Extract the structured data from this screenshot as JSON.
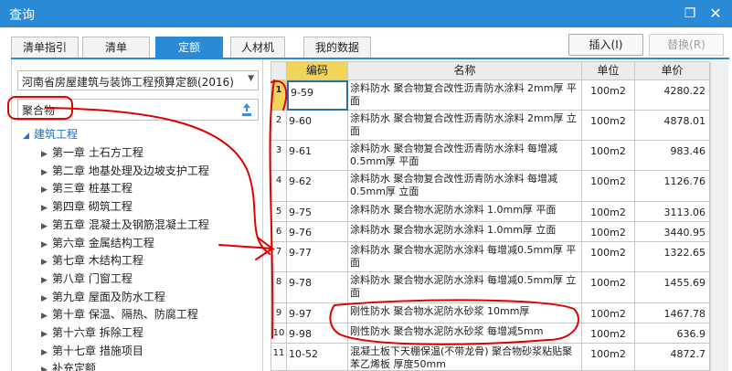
{
  "window": {
    "title": "查询",
    "close_glyph": "✕",
    "max_glyph": "❐"
  },
  "tabs": [
    {
      "label": "清单指引",
      "active": false
    },
    {
      "label": "清单",
      "active": false
    },
    {
      "label": "定额",
      "active": true
    },
    {
      "label": "人材机",
      "active": false
    },
    {
      "label": "我的数据",
      "active": false
    }
  ],
  "buttons": {
    "insert": "插入(I)",
    "replace": "替换(R)"
  },
  "library": {
    "selected": "河南省房屋建筑与装饰工程预算定额(2016)"
  },
  "search": {
    "value": "聚合物"
  },
  "tree": {
    "root": "建筑工程",
    "chapters": [
      "第一章 土石方工程",
      "第二章 地基处理及边坡支护工程",
      "第三章 桩基工程",
      "第四章 砌筑工程",
      "第五章 混凝土及钢筋混凝土工程",
      "第六章 金属结构工程",
      "第七章 木结构工程",
      "第八章 门窗工程",
      "第九章 屋面及防水工程",
      "第十章 保温、隔热、防腐工程",
      "第十六章 拆除工程",
      "第十七章 措施项目",
      "补充定额"
    ]
  },
  "grid": {
    "headers": {
      "code": "编码",
      "name": "名称",
      "unit": "单位",
      "price": "单价"
    },
    "rows": [
      {
        "idx": "1",
        "code": "9-59",
        "name": "涂料防水 聚合物复合改性沥青防水涂料 2mm厚 平面",
        "unit": "100m2",
        "price": "4280.22"
      },
      {
        "idx": "2",
        "code": "9-60",
        "name": "涂料防水 聚合物复合改性沥青防水涂料 2mm厚 立面",
        "unit": "100m2",
        "price": "4878.01"
      },
      {
        "idx": "3",
        "code": "9-61",
        "name": "涂料防水 聚合物复合改性沥青防水涂料 每增减0.5mm厚 平面",
        "unit": "100m2",
        "price": "983.46"
      },
      {
        "idx": "4",
        "code": "9-62",
        "name": "涂料防水 聚合物复合改性沥青防水涂料 每增减0.5mm厚 立面",
        "unit": "100m2",
        "price": "1126.76"
      },
      {
        "idx": "5",
        "code": "9-75",
        "name": "涂料防水 聚合物水泥防水涂料 1.0mm厚 平面",
        "unit": "100m2",
        "price": "3113.06"
      },
      {
        "idx": "6",
        "code": "9-76",
        "name": "涂料防水 聚合物水泥防水涂料 1.0mm厚 立面",
        "unit": "100m2",
        "price": "3440.95"
      },
      {
        "idx": "7",
        "code": "9-77",
        "name": "涂料防水 聚合物水泥防水涂料 每增减0.5mm厚 平面",
        "unit": "100m2",
        "price": "1322.65"
      },
      {
        "idx": "8",
        "code": "9-78",
        "name": "涂料防水 聚合物水泥防水涂料 每增减0.5mm厚 立面",
        "unit": "100m2",
        "price": "1455.69"
      },
      {
        "idx": "9",
        "code": "9-97",
        "name": "刚性防水 聚合物水泥防水砂浆 10mm厚",
        "unit": "100m2",
        "price": "1467.78"
      },
      {
        "idx": "10",
        "code": "9-98",
        "name": "刚性防水 聚合物水泥防水砂浆 每增减5mm",
        "unit": "100m2",
        "price": "636.9"
      },
      {
        "idx": "11",
        "code": "10-52",
        "name": "混凝土板下天棚保温(不带龙骨) 聚合物砂浆粘贴聚苯乙烯板 厚度50mm",
        "unit": "100m2",
        "price": "4872.7"
      }
    ]
  },
  "colors": {
    "accent": "#2b8ad6",
    "header_highlight": "#f3d45a",
    "annotation": "#e00000"
  }
}
